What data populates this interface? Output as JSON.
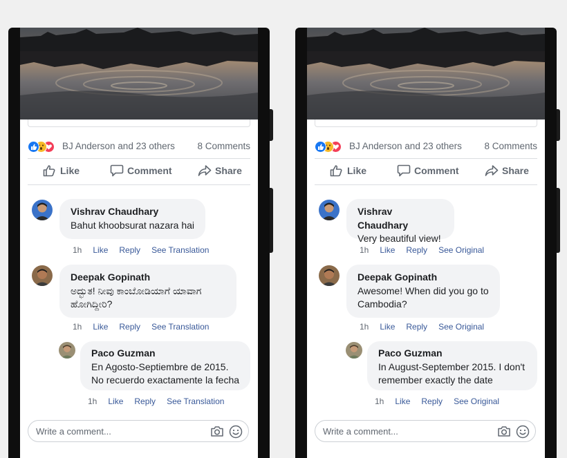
{
  "colors": {
    "like_blue": "#1877f2",
    "love_red": "#f33e58",
    "wow_yellow": "#f7b928",
    "link": "#385898",
    "meta_gray": "#606770"
  },
  "phones": [
    {
      "reactions": {
        "icons": [
          "like-icon",
          "wow-icon",
          "love-icon"
        ],
        "text": "BJ Anderson and 23 others",
        "comments_count": "8 Comments"
      },
      "actions": {
        "like": "Like",
        "comment": "Comment",
        "share": "Share"
      },
      "comments": [
        {
          "author": "Vishrav Chaudhary",
          "text": "Bahut khoobsurat nazara hai",
          "time": "1h",
          "like": "Like",
          "reply": "Reply",
          "translation": "See Translation"
        },
        {
          "author": "Deepak Gopinath",
          "text": "ಅದ್ಭುತ! ನೀವು ಕಾಂಬೋಡಿಯಾಗೆ ಯಾವಾಗ ಹೋಗಿದ್ದೀರಿ?",
          "time": "1h",
          "like": "Like",
          "reply": "Reply",
          "translation": "See Translation"
        },
        {
          "author": "Paco Guzman",
          "text": "En Agosto-Septiembre de 2015. No recuerdo exactamente la fecha",
          "time": "1h",
          "like": "Like",
          "reply": "Reply",
          "translation": "See Translation"
        }
      ],
      "composer": {
        "placeholder": "Write a comment..."
      }
    },
    {
      "reactions": {
        "icons": [
          "like-icon",
          "wow-icon",
          "love-icon"
        ],
        "text": "BJ Anderson and 23 others",
        "comments_count": "8 Comments"
      },
      "actions": {
        "like": "Like",
        "comment": "Comment",
        "share": "Share"
      },
      "comments": [
        {
          "author": "Vishrav Chaudhary",
          "text": "Very beautiful view!",
          "time": "1h",
          "like": "Like",
          "reply": "Reply",
          "translation": "See Original"
        },
        {
          "author": "Deepak Gopinath",
          "text": "Awesome! When did you go to Cambodia?",
          "time": "1h",
          "like": "Like",
          "reply": "Reply",
          "translation": "See Original"
        },
        {
          "author": "Paco Guzman",
          "text": "In August-September 2015. I don't remember exactly the date",
          "time": "1h",
          "like": "Like",
          "reply": "Reply",
          "translation": "See Original"
        }
      ],
      "composer": {
        "placeholder": "Write a comment..."
      }
    }
  ]
}
